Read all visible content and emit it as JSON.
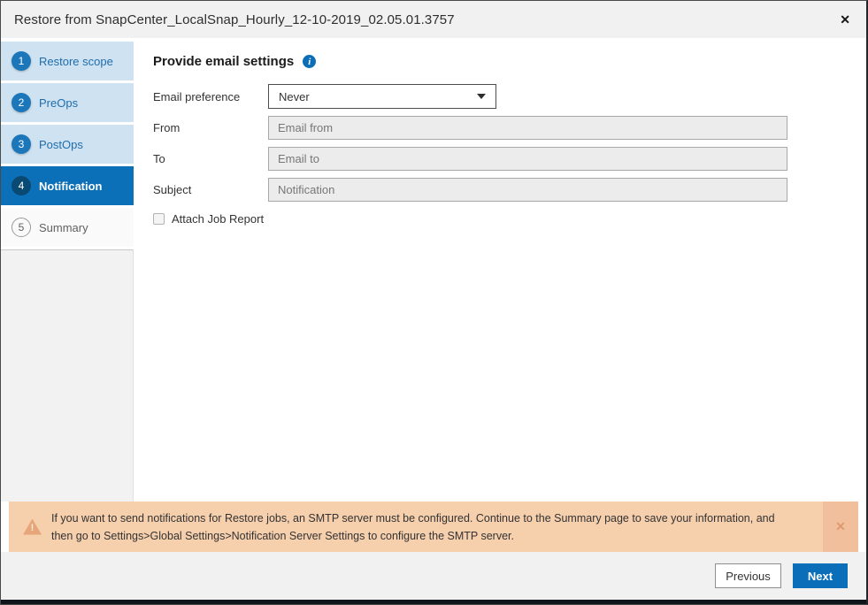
{
  "dialog": {
    "title": "Restore from SnapCenter_LocalSnap_Hourly_12-10-2019_02.05.01.3757"
  },
  "icons": {
    "close": "✕",
    "info": "i",
    "warning": "!",
    "banner_close": "✕"
  },
  "steps": [
    {
      "number": "1",
      "label": "Restore scope",
      "state": "done"
    },
    {
      "number": "2",
      "label": "PreOps",
      "state": "done"
    },
    {
      "number": "3",
      "label": "PostOps",
      "state": "done"
    },
    {
      "number": "4",
      "label": "Notification",
      "state": "active"
    },
    {
      "number": "5",
      "label": "Summary",
      "state": "upcoming"
    }
  ],
  "form": {
    "heading": "Provide email settings",
    "email_preference": {
      "label": "Email preference",
      "value": "Never"
    },
    "from": {
      "label": "From",
      "placeholder": "Email from"
    },
    "to": {
      "label": "To",
      "placeholder": "Email to"
    },
    "subject": {
      "label": "Subject",
      "placeholder": "Notification"
    },
    "attach_job_report": {
      "label": "Attach Job Report",
      "checked": false
    }
  },
  "banner": {
    "text": "If you want to send notifications for Restore jobs, an SMTP server must be configured. Continue to the Summary page to save your information, and then go to Settings>Global Settings>Notification Server Settings to configure the SMTP server."
  },
  "footer": {
    "previous_label": "Previous",
    "next_label": "Next"
  },
  "colors": {
    "accent_blue": "#0c70b8",
    "step_done_bg": "#cfe2f1",
    "step_done_text": "#1d6dad",
    "active_badge": "#0a4a72",
    "banner_bg": "#f6cfad",
    "banner_dismiss_bg": "#f2bf9c",
    "disabled_input_bg": "#ececec",
    "titlebar_bg": "#f1f1f1",
    "footer_bg": "#f1f1f1"
  }
}
